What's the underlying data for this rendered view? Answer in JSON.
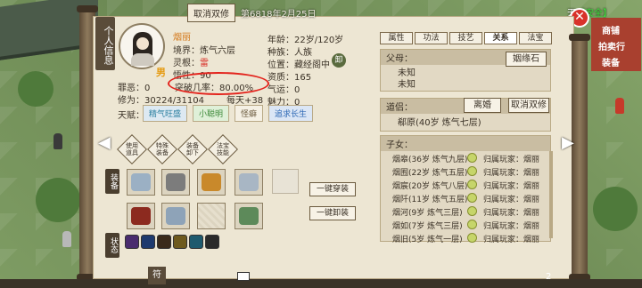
{
  "top": {
    "cancel_cultivate_label": "取消双修",
    "date_text": "第6818年2月25日",
    "safe_prefix": "天",
    "safe_label": "【安全】"
  },
  "panel": {
    "side_title": "个人信息",
    "name": "烟丽",
    "gender": "男",
    "realm": "境界：炼气六层",
    "spirit_root_label": "灵根：",
    "spirit_root_value": "雷",
    "temper": "悟性：90",
    "sin": "罪恶：0",
    "breakthrough": "突破几率：80.00%",
    "cultivation": "修为：30224/31104",
    "per_day": "每天+38",
    "age": "年龄：22岁/120岁",
    "race": "种族：人族",
    "location": "位置：藏经阁中",
    "aptitude": "资质：165",
    "luck": "气运：0",
    "charm": "魅力：0",
    "badge": "卸",
    "talent_label": "天赋：",
    "talents": [
      "精气旺盛",
      "小聪明",
      "怪癖",
      "追求长生"
    ]
  },
  "tabs": [
    "属性",
    "功法",
    "技艺",
    "关系",
    "法宝"
  ],
  "relations": {
    "parents_title": "父母：",
    "parents": [
      "未知",
      "未知"
    ],
    "marry_button": "姻缘石",
    "partner_title": "道侣：",
    "partner": "郗原(40岁 炼气七层)",
    "divorce_button": "离婚",
    "cancel_cultivate_button": "取消双修",
    "children_title": "子女：",
    "children": [
      {
        "name": "烟皋(36岁 炼气九层)",
        "owner": "归属玩家：烟丽"
      },
      {
        "name": "烟囿(22岁 炼气五层)",
        "owner": "归属玩家：烟丽"
      },
      {
        "name": "烟宸(20岁 炼气八层)",
        "owner": "归属玩家：烟丽"
      },
      {
        "name": "烟阡(11岁 炼气五层)",
        "owner": "归属玩家：烟丽"
      },
      {
        "name": "烟河(9岁 炼气三层)",
        "owner": "归属玩家：烟丽"
      },
      {
        "name": "烟如(7岁 炼气三层)",
        "owner": "归属玩家：烟丽"
      },
      {
        "name": "烟旧(5岁 炼气一层)",
        "owner": "归属玩家：烟丽"
      }
    ]
  },
  "skills": [
    "使用道具",
    "特殊装备",
    "装备卸下",
    "法宝技能"
  ],
  "equip_label": "装备",
  "status_label": "状态",
  "equip_all": "一键穿装",
  "unequip_all": "一键卸装",
  "bottom_tag": "符",
  "right_deco": [
    "商铺",
    "拍卖行",
    "装备"
  ],
  "page_indicator": "2"
}
